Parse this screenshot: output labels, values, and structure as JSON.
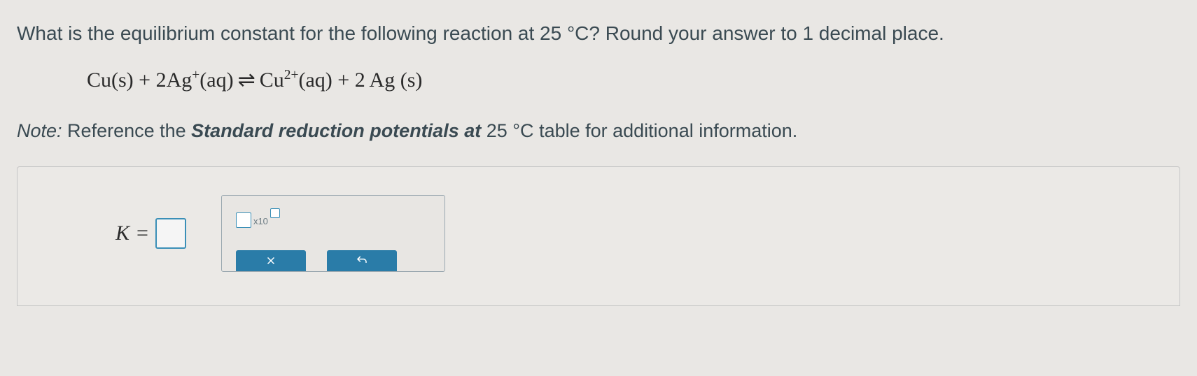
{
  "question": {
    "text_before_temp": "What is the equilibrium constant for the following reaction at ",
    "temp": "25 °C",
    "text_after_temp": "? Round your answer to ",
    "decimal": "1",
    "text_end": " decimal place."
  },
  "equation": {
    "r1": "Cu",
    "r1_state": "(s)",
    "plus1": " + ",
    "r2_coef": "2",
    "r2": "Ag",
    "r2_charge": "+",
    "r2_state": "(aq)",
    "arrow": " ⇌ ",
    "p1": "Cu",
    "p1_charge": "2+",
    "p1_state": "(aq)",
    "plus2": " + ",
    "p2_coef": "2",
    "p2_space": " ",
    "p2": "Ag",
    "p2_state_space": " ",
    "p2_state": "(s)"
  },
  "note": {
    "prefix": "Note:",
    "ref_text": " Reference the ",
    "bold_text": "Standard reduction potentials at",
    "temp": " 25 °C ",
    "suffix": "table for additional information."
  },
  "answer": {
    "k_label": "K",
    "equals": " = ",
    "sci_x10": "x10"
  }
}
